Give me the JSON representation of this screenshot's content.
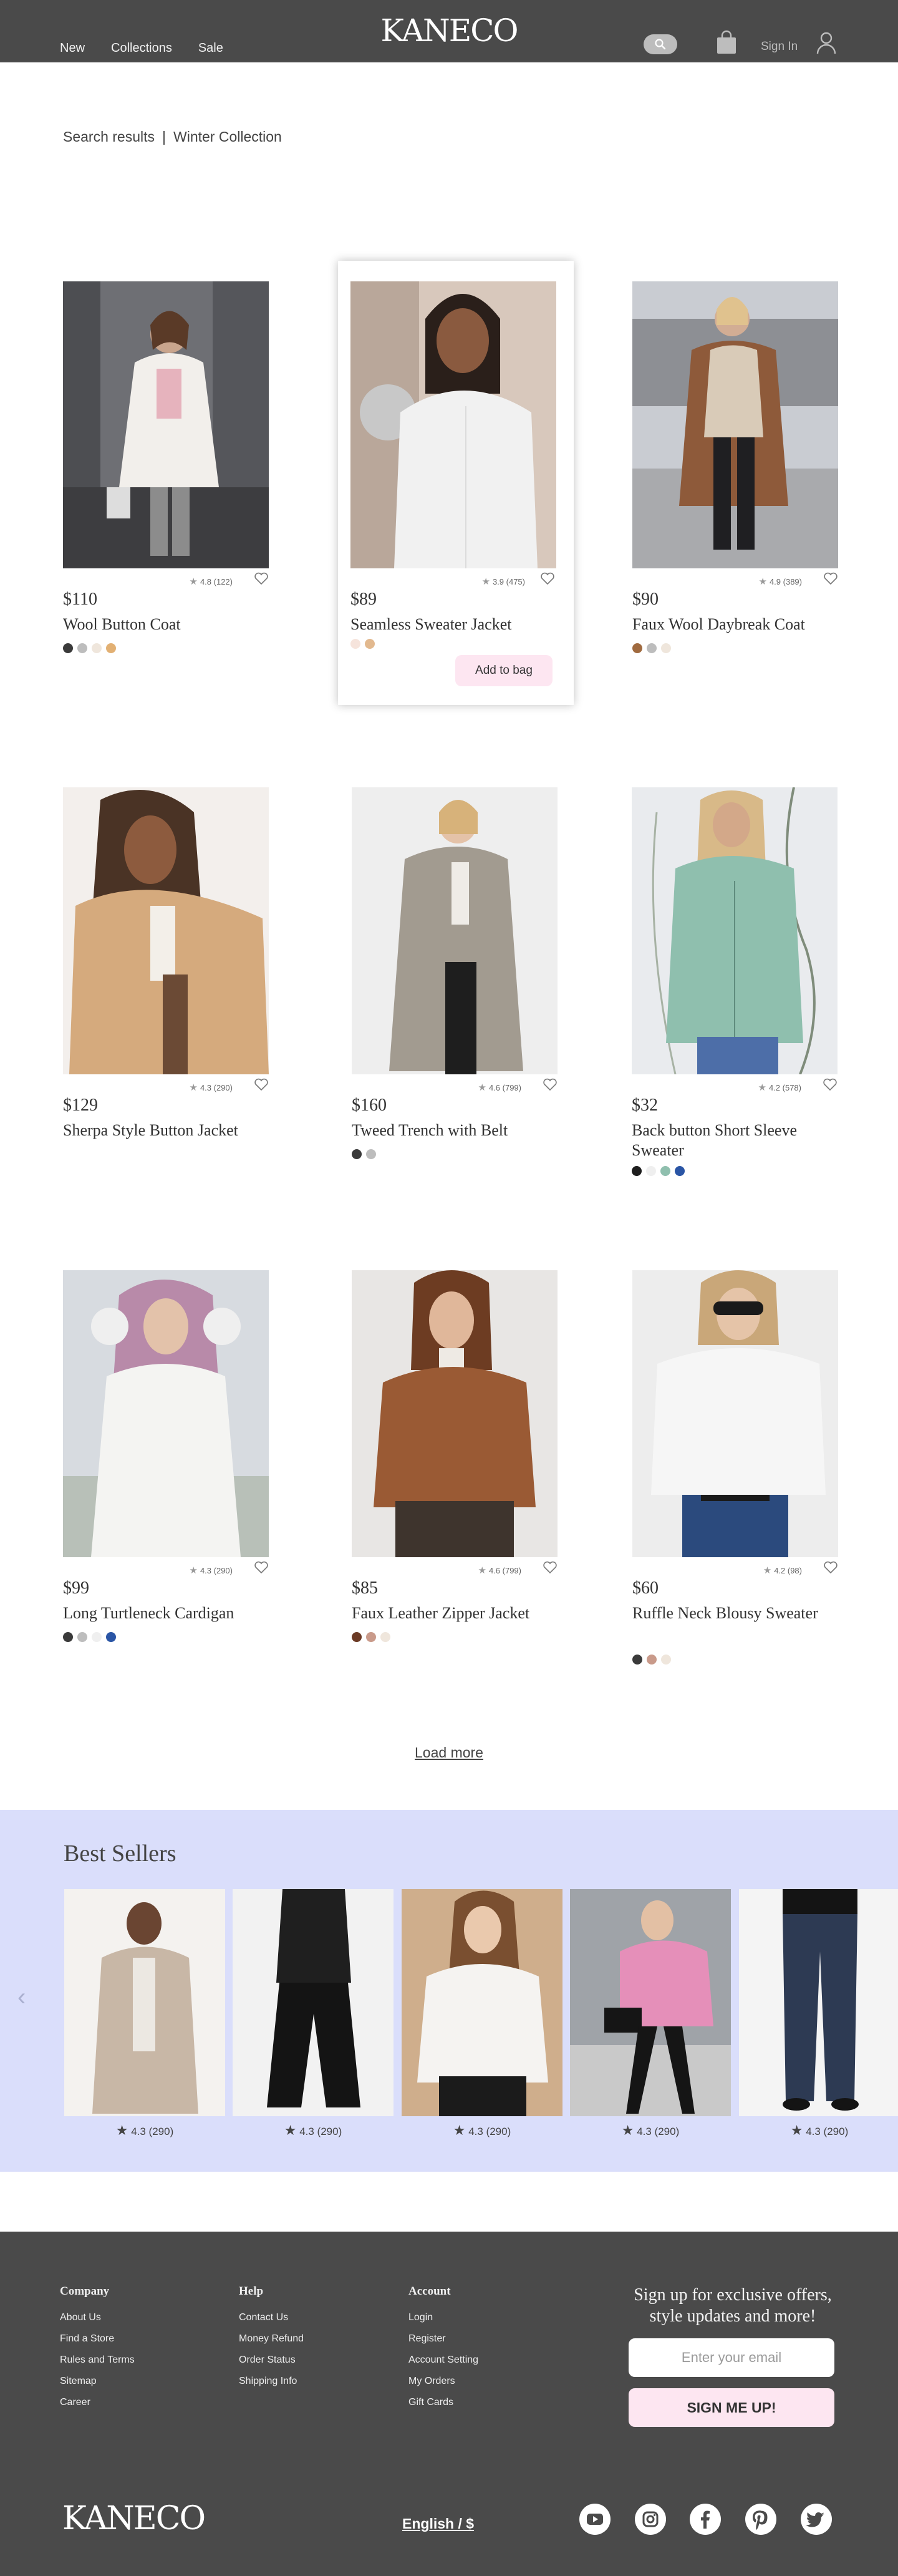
{
  "header": {
    "logo": "KANECO",
    "nav": [
      "New",
      "Collections",
      "Sale"
    ],
    "sign_in": "Sign In"
  },
  "breadcrumb": {
    "first": "Search results",
    "separator": "|",
    "second": "Winter Collection"
  },
  "products": [
    {
      "price": "$110",
      "name": "Wool Button Coat",
      "rating": "4.8 (122)",
      "swatches": [
        "#3a3a3a",
        "#bdbdbd",
        "#efe6dc",
        "#e2b073"
      ]
    },
    {
      "price": "$89",
      "name": "Seamless Sweater Jacket",
      "rating": "3.9 (475)",
      "swatches": [
        "#f6e4dc",
        "#e2b98f"
      ],
      "add_to_bag": "Add to bag"
    },
    {
      "price": "$90",
      "name": "Faux Wool Daybreak Coat",
      "rating": "4.9 (389)",
      "swatches": [
        "#a06a3f",
        "#bdbdbd",
        "#efe6dc"
      ]
    },
    {
      "price": "$129",
      "name": "Sherpa Style Button Jacket",
      "rating": "4.3 (290)",
      "swatches": []
    },
    {
      "price": "$160",
      "name": "Tweed Trench with Belt",
      "rating": "4.6 (799)",
      "swatches": [
        "#3a3a3a",
        "#bdbdbd"
      ]
    },
    {
      "price": "$32",
      "name": "Back button Short Sleeve Sweater",
      "rating": "4.2 (578)",
      "swatches": [
        "#1e1e1e",
        "#efefef",
        "#8fbfae",
        "#2a55a5"
      ]
    },
    {
      "price": "$99",
      "name": "Long Turtleneck Cardigan",
      "rating": "4.3 (290)",
      "swatches": [
        "#3a3a3a",
        "#bdbdbd",
        "#efefef",
        "#2a55a5"
      ]
    },
    {
      "price": "$85",
      "name": "Faux Leather Zipper Jacket",
      "rating": "4.6 (799)",
      "swatches": [
        "#6b3a25",
        "#c99a8a",
        "#efe6dc"
      ]
    },
    {
      "price": "$60",
      "name": "Ruffle Neck Blousy Sweater",
      "rating": "4.2 (98)",
      "swatches": [
        "#3a3a3a",
        "#c99a8a",
        "#efe6dc"
      ]
    }
  ],
  "load_more": "Load more",
  "best_sellers": {
    "title": "Best Sellers",
    "ratings": [
      "4.3 (290)",
      "4.3 (290)",
      "4.3 (290)",
      "4.3 (290)",
      "4.3 (290)"
    ]
  },
  "footer": {
    "company": {
      "title": "Company",
      "links": [
        "About Us",
        "Find a Store",
        "Rules and Terms",
        "Sitemap",
        "Career"
      ]
    },
    "help": {
      "title": "Help",
      "links": [
        "Contact Us",
        "Money Refund",
        "Order Status",
        "Shipping Info"
      ]
    },
    "account": {
      "title": "Account",
      "links": [
        "Login",
        "Register",
        "Account Setting",
        "My Orders",
        "Gift Cards"
      ]
    },
    "signup_text": "Sign up for exclusive offers, style updates and more!",
    "email_placeholder": "Enter your email",
    "signup_button": "SIGN ME UP!",
    "logo": "KANECO",
    "language": "English / $"
  },
  "colors": {
    "header_bg": "#4a4a4a",
    "best_sellers_bg": "#dadefb",
    "accent_pink": "#fde6f1"
  }
}
